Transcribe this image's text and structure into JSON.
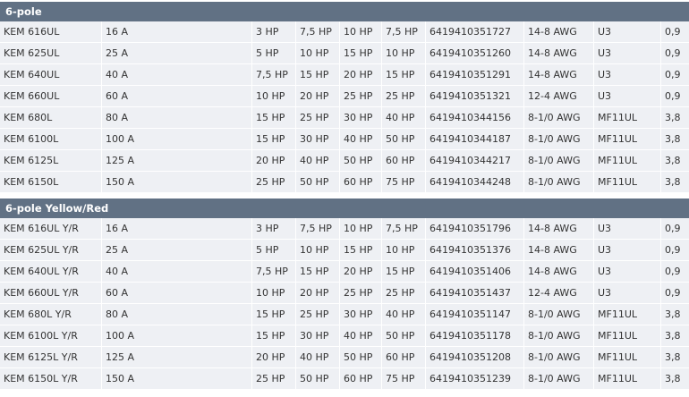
{
  "sections": [
    {
      "title": "6-pole",
      "rows": [
        [
          "KEM 616UL",
          "16 A",
          "3 HP",
          "7,5 HP",
          "10 HP",
          "7,5 HP",
          "6419410351727",
          "14-8 AWG",
          "U3",
          "0,9"
        ],
        [
          "KEM 625UL",
          "25 A",
          "5 HP",
          "10 HP",
          "15 HP",
          "10 HP",
          "6419410351260",
          "14-8 AWG",
          "U3",
          "0,9"
        ],
        [
          "KEM 640UL",
          "40 A",
          "7,5 HP",
          "15 HP",
          "20 HP",
          "15 HP",
          "6419410351291",
          "14-8 AWG",
          "U3",
          "0,9"
        ],
        [
          "KEM 660UL",
          "60 A",
          "10 HP",
          "20 HP",
          "25 HP",
          "25 HP",
          "6419410351321",
          "12-4 AWG",
          "U3",
          "0,9"
        ],
        [
          "KEM 680L",
          "80 A",
          "15 HP",
          "25 HP",
          "30 HP",
          "40 HP",
          "6419410344156",
          "8-1/0 AWG",
          "MF11UL",
          "3,8"
        ],
        [
          "KEM 6100L",
          "100 A",
          "15 HP",
          "30 HP",
          "40 HP",
          "50 HP",
          "6419410344187",
          "8-1/0 AWG",
          "MF11UL",
          "3,8"
        ],
        [
          "KEM 6125L",
          "125 A",
          "20 HP",
          "40 HP",
          "50 HP",
          "60 HP",
          "6419410344217",
          "8-1/0 AWG",
          "MF11UL",
          "3,8"
        ],
        [
          "KEM 6150L",
          "150 A",
          "25 HP",
          "50 HP",
          "60 HP",
          "75 HP",
          "6419410344248",
          "8-1/0 AWG",
          "MF11UL",
          "3,8"
        ]
      ]
    },
    {
      "title": "6-pole Yellow/Red",
      "rows": [
        [
          "KEM 616UL Y/R",
          "16 A",
          "3 HP",
          "7,5 HP",
          "10 HP",
          "7,5 HP",
          "6419410351796",
          "14-8 AWG",
          "U3",
          "0,9"
        ],
        [
          "KEM 625UL Y/R",
          "25 A",
          "5 HP",
          "10 HP",
          "15 HP",
          "10 HP",
          "6419410351376",
          "14-8 AWG",
          "U3",
          "0,9"
        ],
        [
          "KEM 640UL Y/R",
          "40 A",
          "7,5 HP",
          "15 HP",
          "20 HP",
          "15 HP",
          "6419410351406",
          "14-8 AWG",
          "U3",
          "0,9"
        ],
        [
          "KEM 660UL Y/R",
          "60 A",
          "10 HP",
          "20 HP",
          "25 HP",
          "25 HP",
          "6419410351437",
          "12-4 AWG",
          "U3",
          "0,9"
        ],
        [
          "KEM 680L Y/R",
          "80 A",
          "15 HP",
          "25 HP",
          "30 HP",
          "40 HP",
          "6419410351147",
          "8-1/0 AWG",
          "MF11UL",
          "3,8"
        ],
        [
          "KEM 6100L Y/R",
          "100 A",
          "15 HP",
          "30 HP",
          "40 HP",
          "50 HP",
          "6419410351178",
          "8-1/0 AWG",
          "MF11UL",
          "3,8"
        ],
        [
          "KEM 6125L Y/R",
          "125 A",
          "20 HP",
          "40 HP",
          "50 HP",
          "60 HP",
          "6419410351208",
          "8-1/0 AWG",
          "MF11UL",
          "3,8"
        ],
        [
          "KEM 6150L Y/R",
          "150 A",
          "25 HP",
          "50 HP",
          "60 HP",
          "75 HP",
          "6419410351239",
          "8-1/0 AWG",
          "MF11UL",
          "3,8"
        ]
      ]
    }
  ]
}
